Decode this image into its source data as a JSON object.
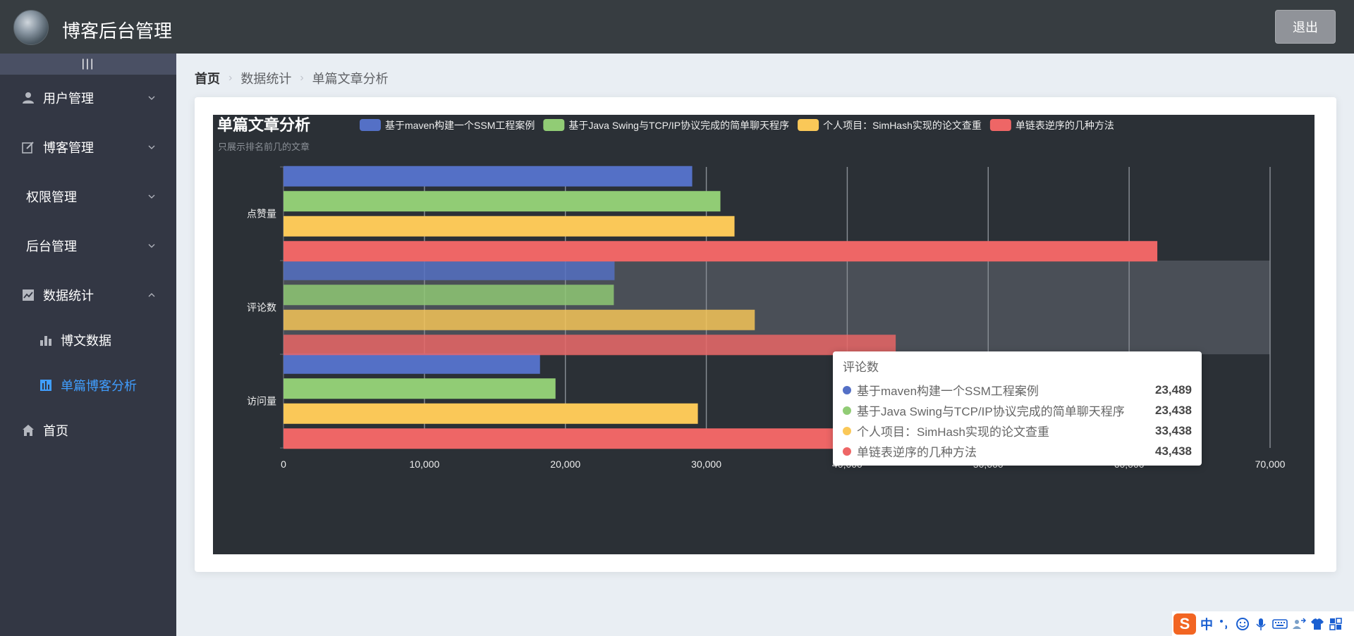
{
  "header": {
    "title": "博客后台管理",
    "logout_label": "退出"
  },
  "sidebar": {
    "collapse_label": "|||",
    "items": [
      {
        "label": "用户管理",
        "icon": "user-icon",
        "expanded": false
      },
      {
        "label": "博客管理",
        "icon": "edit-icon",
        "expanded": false
      },
      {
        "label": "权限管理",
        "icon": "",
        "expanded": false
      },
      {
        "label": "后台管理",
        "icon": "",
        "expanded": false
      },
      {
        "label": "数据统计",
        "icon": "line-chart-icon",
        "expanded": true
      },
      {
        "label": "首页",
        "icon": "home-icon",
        "expanded": false
      }
    ],
    "subitems": [
      {
        "label": "博文数据",
        "icon": "bar-chart-icon",
        "active": false
      },
      {
        "label": "单篇博客分析",
        "icon": "chart-icon",
        "active": true
      }
    ]
  },
  "breadcrumb": {
    "home": "首页",
    "level1": "数据统计",
    "level2": "单篇文章分析"
  },
  "chart_data": {
    "type": "bar",
    "orientation": "horizontal",
    "title": "单篇文章分析",
    "subtitle": "只展示排名前几的文章",
    "categories": [
      "点赞量",
      "评论数",
      "访问量"
    ],
    "series": [
      {
        "name": "基于maven构建一个SSM工程案例",
        "color": "#5470c6",
        "values": [
          29000,
          23489,
          18200
        ]
      },
      {
        "name": "基于Java Swing与TCP/IP协议完成的简单聊天程序",
        "color": "#91cc75",
        "values": [
          31000,
          23438,
          19300
        ]
      },
      {
        "name": "个人项目：SimHash实现的论文查重",
        "color": "#fac858",
        "values": [
          32000,
          33438,
          29400
        ]
      },
      {
        "name": "单链表逆序的几种方法",
        "color": "#ee6666",
        "values": [
          62000,
          43438,
          59500
        ]
      }
    ],
    "xlim": [
      0,
      70000
    ],
    "x_ticks": [
      "0",
      "10,000",
      "20,000",
      "30,000",
      "40,000",
      "50,000",
      "60,000",
      "70,000"
    ],
    "grid": true,
    "legend_position": "top",
    "highlighted_category": "评论数"
  },
  "tooltip": {
    "title": "评论数",
    "rows": [
      {
        "name": "基于maven构建一个SSM工程案例",
        "value": "23,489",
        "color": "#5470c6"
      },
      {
        "name": "基于Java Swing与TCP/IP协议完成的简单聊天程序",
        "value": "23,438",
        "color": "#91cc75"
      },
      {
        "name": "个人项目：SimHash实现的论文查重",
        "value": "33,438",
        "color": "#fac858"
      },
      {
        "name": "单链表逆序的几种方法",
        "value": "43,438",
        "color": "#ee6666"
      }
    ]
  },
  "ime": {
    "logo": "S",
    "lang": "中"
  }
}
